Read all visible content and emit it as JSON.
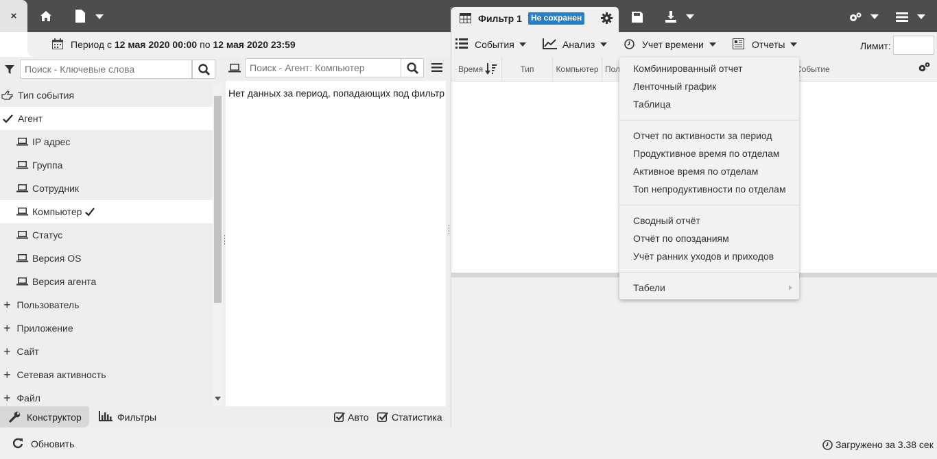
{
  "header": {
    "close_label": "×",
    "filter_tab_title": "Фильтр 1",
    "unsaved_badge": "Не сохранен"
  },
  "period": {
    "prefix": "Период с ",
    "from": "12 мая 2020 00:00",
    "middle": " по ",
    "to": "12 мая 2020 23:59"
  },
  "toolbar": {
    "events": "События",
    "analysis": "Анализ",
    "time_tracking": "Учет времени",
    "reports": "Отчеты",
    "limit_label": "Лимит:"
  },
  "left_search": {
    "placeholder": "Поиск - Ключевые слова"
  },
  "mid_search": {
    "placeholder": "Поиск - Агент: Компьютер"
  },
  "tree": {
    "event_type": "Тип события",
    "agent": "Агент",
    "agent_children": [
      "IP адрес",
      "Группа",
      "Сотрудник",
      "Компьютер",
      "Статус",
      "Версия OS",
      "Версия агента"
    ],
    "groups": [
      "Пользователь",
      "Приложение",
      "Сайт",
      "Сетевая активность",
      "Файл"
    ]
  },
  "middle": {
    "no_data": "Нет данных за период, попадающих под фильтр"
  },
  "columns": [
    "Время",
    "Тип",
    "Компьютер",
    "Пол",
    "Событие"
  ],
  "menu": {
    "group1": [
      "Комбинированный отчет",
      "Ленточный график",
      "Таблица"
    ],
    "group2": [
      "Отчет по активности за период",
      "Продуктивное время по отделам",
      "Активное время по отделам",
      "Топ непродуктивности по отделам"
    ],
    "group3": [
      "Сводный отчёт",
      "Отчёт по опозданиям",
      "Учёт ранних уходов и приходов"
    ],
    "group4": [
      "Табели"
    ]
  },
  "bottom_tabs": {
    "constructor": "Конструктор",
    "filters": "Фильтры",
    "auto": "Авто",
    "statistics": "Статистика"
  },
  "status": {
    "refresh": "Обновить",
    "loaded": "Загружено за 3.38 сек"
  },
  "colors": {
    "topbar": "#4d4d4d",
    "badge": "#2a7fc4",
    "panel": "#f0f0f0"
  }
}
